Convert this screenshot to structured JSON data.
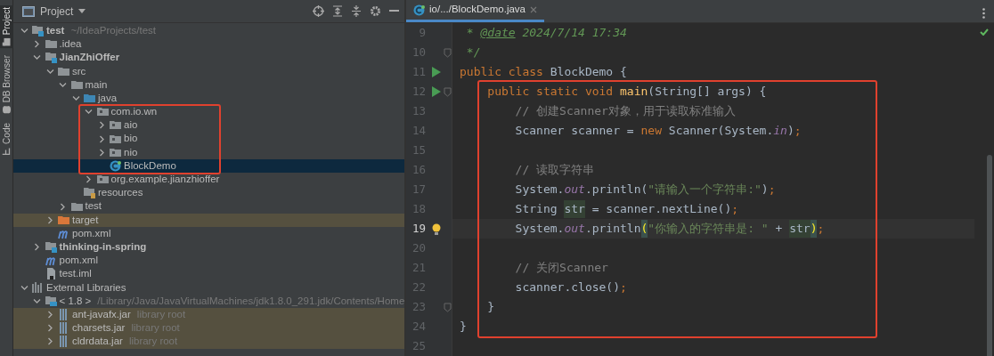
{
  "tool_strip": [
    {
      "label": "Project",
      "selected": true,
      "kind": "folder"
    },
    {
      "label": "DB Browser",
      "selected": false,
      "kind": "database"
    },
    {
      "label": "Code",
      "selected": false,
      "kind": "structure"
    }
  ],
  "project_panel": {
    "title": "Project",
    "tree": [
      {
        "label": "test",
        "hint": "~/IdeaProjects/test",
        "bold": true,
        "kind": "module",
        "expanded": true,
        "selected": false,
        "children": [
          {
            "label": ".idea",
            "kind": "folder",
            "expanded": false,
            "selected": false
          },
          {
            "label": "JianZhiOffer",
            "bold": true,
            "kind": "module",
            "expanded": true,
            "selected": false,
            "children": [
              {
                "label": "src",
                "kind": "folder",
                "expanded": true,
                "selected": false,
                "children": [
                  {
                    "label": "main",
                    "kind": "folder",
                    "expanded": true,
                    "selected": false,
                    "children": [
                      {
                        "label": "java",
                        "kind": "source",
                        "expanded": true,
                        "selected": false,
                        "children": [
                          {
                            "label": "com.io.wn",
                            "kind": "package",
                            "expanded": true,
                            "selected": false,
                            "boxed": true,
                            "children": [
                              {
                                "label": "aio",
                                "kind": "package",
                                "expanded": false,
                                "selected": false
                              },
                              {
                                "label": "bio",
                                "kind": "package",
                                "expanded": false,
                                "selected": false
                              },
                              {
                                "label": "nio",
                                "kind": "package",
                                "expanded": false,
                                "selected": false
                              },
                              {
                                "label": "BlockDemo",
                                "kind": "class",
                                "selected": true
                              }
                            ]
                          },
                          {
                            "label": "org.example.jianzhioffer",
                            "kind": "package",
                            "expanded": false,
                            "selected": false
                          }
                        ]
                      },
                      {
                        "label": "resources",
                        "kind": "resources",
                        "selected": false
                      }
                    ]
                  },
                  {
                    "label": "test",
                    "kind": "folder",
                    "expanded": false,
                    "selected": false
                  }
                ]
              },
              {
                "label": "target",
                "kind": "excluded",
                "expanded": false,
                "selected": false,
                "tinted": true
              },
              {
                "label": "pom.xml",
                "kind": "maven",
                "selected": false
              }
            ]
          },
          {
            "label": "thinking-in-spring",
            "bold": true,
            "kind": "module",
            "expanded": false,
            "selected": false
          },
          {
            "label": "pom.xml",
            "kind": "maven",
            "selected": false
          },
          {
            "label": "test.iml",
            "kind": "iml",
            "selected": false
          }
        ]
      },
      {
        "label": "External Libraries",
        "kind": "libraries",
        "expanded": true,
        "selected": false,
        "children": [
          {
            "label": "< 1.8 >",
            "hint": "/Library/Java/JavaVirtualMachines/jdk1.8.0_291.jdk/Contents/Home",
            "kind": "jdk",
            "expanded": true,
            "selected": false,
            "children": [
              {
                "label": "ant-javafx.jar",
                "hint": "library root",
                "kind": "jar",
                "expanded": false,
                "selected": false,
                "tinted": true
              },
              {
                "label": "charsets.jar",
                "hint": "library root",
                "kind": "jar",
                "expanded": false,
                "selected": false,
                "tinted": true
              },
              {
                "label": "cldrdata.jar",
                "hint": "library root",
                "kind": "jar",
                "expanded": false,
                "selected": false,
                "tinted": true
              }
            ]
          }
        ]
      }
    ]
  },
  "editor": {
    "tabs": [
      {
        "label": "io/.../BlockDemo.java",
        "selected": true
      }
    ],
    "blocks": [
      {
        "lines": [
          {
            "number": "9",
            "tokens": [
              {
                "kind": "doc",
                "text": " * "
              },
              {
                "kind": "doctag",
                "text": "@date"
              },
              {
                "kind": "doc",
                "text": " 2024/7/14 17:34"
              }
            ]
          },
          {
            "number": "10",
            "fold": true,
            "tokens": [
              {
                "kind": "doc",
                "text": " */"
              }
            ]
          },
          {
            "number": "11",
            "run": true,
            "tokens": [
              {
                "kind": "kw",
                "text": "public class "
              },
              {
                "kind": "plain",
                "text": "BlockDemo {"
              }
            ]
          }
        ]
      },
      {
        "boxed": true,
        "lines": [
          {
            "number": "12",
            "run": true,
            "fold": true,
            "tokens": [
              {
                "kind": "kw",
                "text": "    public static void "
              },
              {
                "kind": "method",
                "text": "main"
              },
              {
                "kind": "plain",
                "text": "(String[] args) {"
              }
            ]
          },
          {
            "number": "13",
            "tokens": [
              {
                "kind": "comment",
                "text": "        // 创建Scanner对象，用于读取标准输入"
              }
            ]
          },
          {
            "number": "14",
            "tokens": [
              {
                "kind": "plain",
                "text": "        Scanner scanner = "
              },
              {
                "kind": "kw",
                "text": "new"
              },
              {
                "kind": "plain",
                "text": " Scanner(System."
              },
              {
                "kind": "field",
                "text": "in"
              },
              {
                "kind": "plain",
                "text": ")"
              },
              {
                "kind": "punct",
                "text": ";"
              }
            ]
          },
          {
            "number": "15"
          },
          {
            "number": "16",
            "tokens": [
              {
                "kind": "comment",
                "text": "        // 读取字符串"
              }
            ]
          },
          {
            "number": "17",
            "tokens": [
              {
                "kind": "plain",
                "text": "        System."
              },
              {
                "kind": "field",
                "text": "out"
              },
              {
                "kind": "plain",
                "text": ".println("
              },
              {
                "kind": "str",
                "text": "\"请输入一个字符串:\""
              },
              {
                "kind": "plain",
                "text": ")"
              },
              {
                "kind": "punct",
                "text": ";"
              }
            ]
          },
          {
            "number": "18",
            "tokens": [
              {
                "kind": "plain",
                "text": "        String "
              },
              {
                "kind": "usage",
                "text": "str"
              },
              {
                "kind": "plain",
                "text": " = scanner.nextLine()"
              },
              {
                "kind": "punct",
                "text": ";"
              }
            ]
          },
          {
            "number": "19",
            "bulb": true,
            "current": true,
            "tokens": [
              {
                "kind": "plain",
                "text": "        System."
              },
              {
                "kind": "field",
                "text": "out"
              },
              {
                "kind": "plain",
                "text": ".println"
              },
              {
                "kind": "match",
                "text": "("
              },
              {
                "kind": "str",
                "text": "\"你输入的字符串是: \""
              },
              {
                "kind": "plain",
                "text": " + "
              },
              {
                "kind": "usage",
                "text": "str"
              },
              {
                "kind": "match",
                "text": ")"
              },
              {
                "kind": "punct",
                "text": ";"
              }
            ]
          },
          {
            "number": "20"
          },
          {
            "number": "21",
            "tokens": [
              {
                "kind": "comment",
                "text": "        // 关闭Scanner"
              }
            ]
          },
          {
            "number": "22",
            "tokens": [
              {
                "kind": "plain",
                "text": "        scanner.close()"
              },
              {
                "kind": "punct",
                "text": ";"
              }
            ]
          },
          {
            "number": "23",
            "fold": true,
            "tokens": [
              {
                "kind": "plain",
                "text": "    }"
              }
            ]
          }
        ]
      },
      {
        "lines": [
          {
            "number": "24",
            "tokens": [
              {
                "kind": "plain",
                "text": "}"
              }
            ]
          },
          {
            "number": "25"
          }
        ]
      }
    ]
  }
}
